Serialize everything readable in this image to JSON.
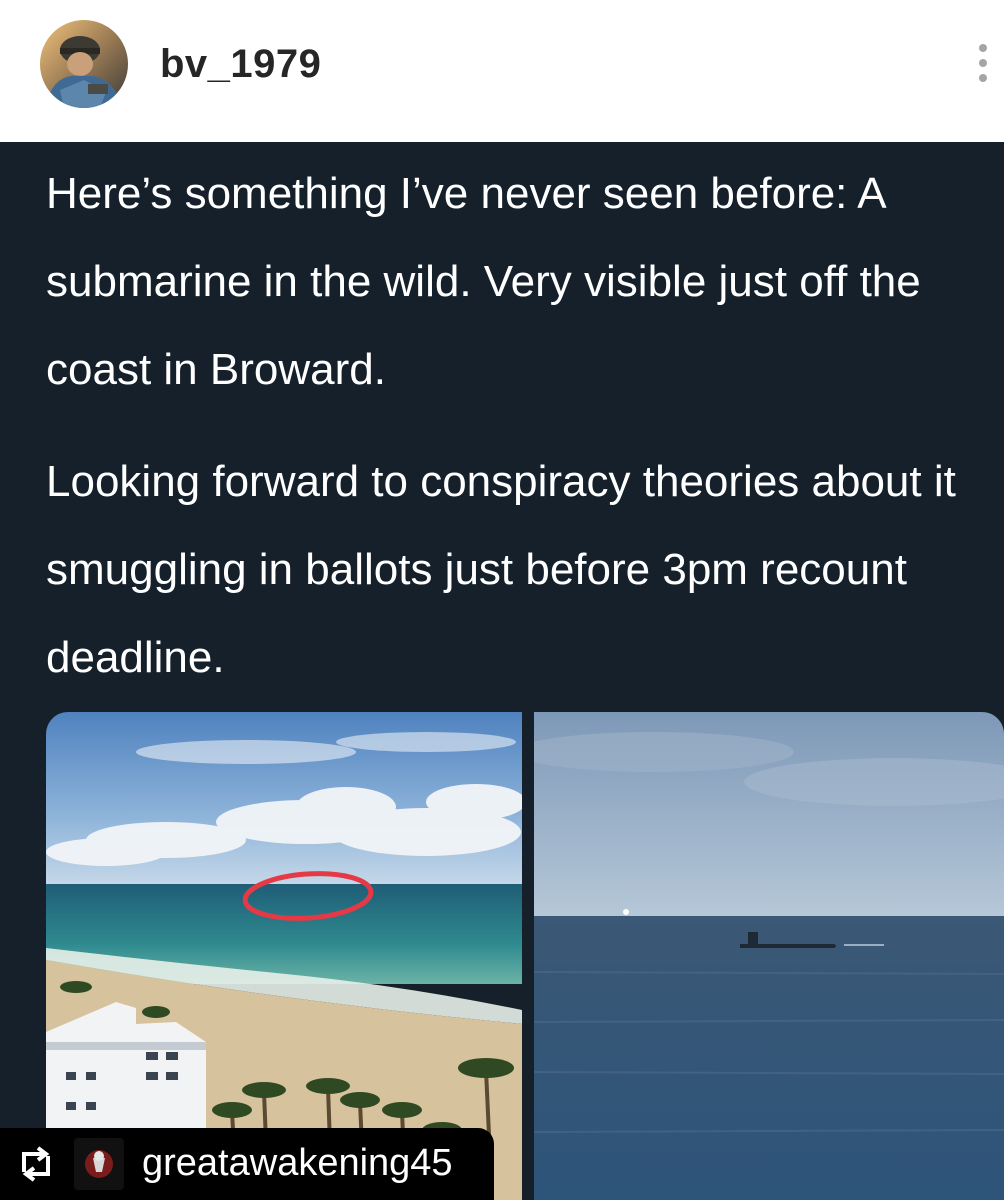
{
  "post": {
    "username": "bv_1979"
  },
  "tweet": {
    "paragraphs": [
      "Here’s something I’ve never seen before: A submarine in the wild. Very visible just off the coast in Broward.",
      "Looking forward to conspiracy theories about it smuggling in ballots just before 3pm recount deadline."
    ]
  },
  "repost": {
    "account": "greatawakening45"
  },
  "colors": {
    "tweet_background": "#15202b",
    "highlight_circle": "#e53945"
  },
  "icons": {
    "more": "more-vertical-icon",
    "repost": "repost-icon"
  }
}
